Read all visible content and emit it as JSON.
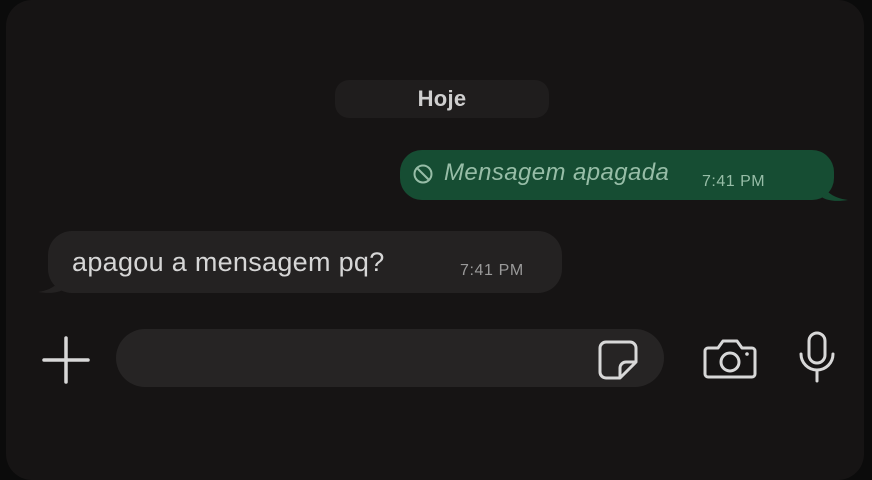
{
  "conversation": {
    "date_separator": "Hoje",
    "messages": [
      {
        "direction": "outgoing",
        "deleted": true,
        "text": "Mensagem apagada",
        "time": "7:41 PM",
        "icon": "no-entry-icon"
      },
      {
        "direction": "incoming",
        "deleted": false,
        "text": "apagou a mensagem pq?",
        "time": "7:41 PM"
      }
    ]
  },
  "composer": {
    "value": "",
    "icons": {
      "attach": "plus-icon",
      "sticker": "sticker-icon",
      "camera": "camera-icon",
      "voice": "microphone-icon"
    }
  },
  "colors": {
    "background": "#161414",
    "outgoing_bubble": "#164d33",
    "incoming_bubble": "#242222",
    "outgoing_text": "#97bda7",
    "incoming_text": "#d6d6d6"
  }
}
